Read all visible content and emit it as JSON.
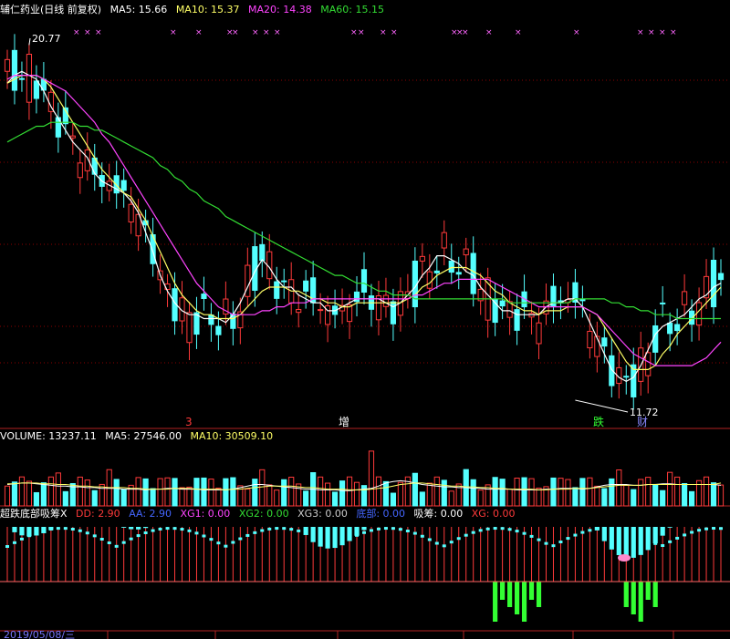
{
  "header": {
    "title": "辅仁药业(日线 前复权)",
    "ma5": "MA5: 15.66",
    "ma10": "MA10: 15.37",
    "ma20": "MA20: 14.38",
    "ma60": "MA60: 15.15"
  },
  "volume_header": {
    "title": "VOLUME: 13237.11",
    "ma5": "MA5: 27546.00",
    "ma10": "MA10: 30509.10"
  },
  "indicator_header": {
    "title": "超跌底部吸筹X",
    "dd": "DD: 2.90",
    "aa": "AA: 2.90",
    "xg1": "XG1: 0.00",
    "xg2": "XG2: 0.00",
    "xg3": "XG3: 0.00",
    "bottom": "底部: 0.00",
    "absorb": "吸筹: 0.00",
    "xg": "XG: 0.00"
  },
  "annotations": {
    "high_label": "20.77",
    "low_label": "11.72",
    "marker_1": "3",
    "marker_2": "增",
    "marker_3": "跌",
    "marker_4": "财"
  },
  "date_label": "2019/05/08/三",
  "colors": {
    "up": "#ff3a3a",
    "down": "#54ffff",
    "ma5": "#ffffff",
    "ma10": "#ffff66",
    "ma20": "#ff44ff",
    "ma60": "#33dd33",
    "grid": "#8b0000",
    "axis": "#b22222",
    "marker_x": "#ff66ff"
  },
  "chart_data": [
    {
      "type": "candlestick",
      "title": "辅仁药业(日线 前复权)",
      "ylim": [
        11,
        21.5
      ],
      "annotations": [
        {
          "text": "20.77",
          "x": 3,
          "y": 20.77
        },
        {
          "text": "11.72",
          "x": 112,
          "y": 11.72
        }
      ],
      "series": [
        {
          "name": "MA5",
          "values": [
            19.8,
            20.0,
            20.1,
            20.0,
            19.9,
            19.6,
            19.2,
            18.9,
            18.6,
            18.3,
            18.1,
            17.9,
            17.5,
            17.3,
            17.2,
            17.1,
            17.0,
            16.8,
            16.5,
            16.0,
            15.5,
            14.9,
            14.5,
            14.2,
            14.0,
            13.9,
            13.9,
            13.8,
            13.8,
            13.8,
            13.7,
            13.9,
            14.2,
            14.6,
            15.0,
            15.3,
            15.1,
            14.8,
            14.6,
            14.6,
            14.4,
            14.3,
            14.2,
            14.2,
            14.0,
            14.0,
            14.1,
            14.2,
            14.3,
            14.3,
            14.3,
            14.3,
            14.2,
            14.1,
            14.2,
            14.4,
            14.6,
            14.9,
            15.1,
            15.4,
            15.4,
            15.3,
            15.2,
            15.0,
            14.9,
            14.6,
            14.4,
            14.2,
            14.0,
            14.0,
            13.9,
            13.9,
            13.9,
            13.9,
            14.1,
            14.2,
            14.2,
            14.3,
            14.3,
            14.1,
            13.7,
            13.3,
            12.9,
            12.5,
            12.3,
            12.2,
            12.3,
            12.6,
            13.0,
            13.4,
            13.6,
            13.7,
            13.8,
            13.9,
            14.1,
            14.3,
            14.4,
            14.6,
            14.7
          ]
        },
        {
          "name": "MA10",
          "values": [
            19.8,
            19.9,
            20.0,
            20.0,
            20.0,
            19.9,
            19.7,
            19.4,
            19.1,
            18.8,
            18.5,
            18.2,
            17.9,
            17.6,
            17.4,
            17.2,
            17.0,
            16.9,
            16.6,
            16.3,
            15.9,
            15.5,
            15.1,
            14.7,
            14.4,
            14.2,
            14.0,
            13.9,
            13.9,
            13.8,
            13.8,
            13.8,
            13.9,
            14.1,
            14.3,
            14.5,
            14.6,
            14.6,
            14.6,
            14.5,
            14.5,
            14.4,
            14.3,
            14.3,
            14.2,
            14.2,
            14.1,
            14.1,
            14.2,
            14.2,
            14.2,
            14.2,
            14.2,
            14.2,
            14.2,
            14.3,
            14.4,
            14.6,
            14.7,
            14.9,
            15.0,
            15.1,
            15.1,
            15.1,
            15.0,
            14.9,
            14.7,
            14.5,
            14.4,
            14.2,
            14.1,
            14.0,
            14.0,
            13.9,
            14.0,
            14.0,
            14.0,
            14.1,
            14.1,
            14.1,
            14.0,
            13.9,
            13.6,
            13.3,
            13.0,
            12.7,
            12.5,
            12.5,
            12.5,
            12.6,
            12.9,
            13.1,
            13.4,
            13.6,
            13.8,
            14.0,
            14.2,
            14.4,
            14.6
          ]
        },
        {
          "name": "MA20",
          "values": [
            19.9,
            20.0,
            20.0,
            20.0,
            20.0,
            19.9,
            19.8,
            19.7,
            19.6,
            19.4,
            19.2,
            19.0,
            18.8,
            18.5,
            18.3,
            18.0,
            17.7,
            17.4,
            17.1,
            16.8,
            16.5,
            16.2,
            15.9,
            15.6,
            15.3,
            15.0,
            14.7,
            14.5,
            14.3,
            14.1,
            14.0,
            13.9,
            13.9,
            13.9,
            13.9,
            14.0,
            14.0,
            14.1,
            14.1,
            14.2,
            14.2,
            14.2,
            14.3,
            14.3,
            14.3,
            14.3,
            14.3,
            14.3,
            14.3,
            14.3,
            14.3,
            14.3,
            14.3,
            14.3,
            14.3,
            14.3,
            14.4,
            14.4,
            14.5,
            14.6,
            14.7,
            14.7,
            14.8,
            14.8,
            14.8,
            14.8,
            14.8,
            14.7,
            14.6,
            14.5,
            14.4,
            14.3,
            14.2,
            14.1,
            14.1,
            14.1,
            14.1,
            14.1,
            14.1,
            14.1,
            14.0,
            13.9,
            13.7,
            13.5,
            13.3,
            13.1,
            12.9,
            12.8,
            12.7,
            12.6,
            12.6,
            12.6,
            12.6,
            12.6,
            12.6,
            12.7,
            12.8,
            13.0,
            13.2
          ]
        },
        {
          "name": "MA60",
          "values": [
            18.3,
            18.4,
            18.5,
            18.6,
            18.7,
            18.7,
            18.8,
            18.8,
            18.8,
            18.8,
            18.7,
            18.7,
            18.6,
            18.6,
            18.5,
            18.4,
            18.3,
            18.2,
            18.1,
            18.0,
            17.9,
            17.7,
            17.6,
            17.4,
            17.3,
            17.1,
            17.0,
            16.8,
            16.7,
            16.6,
            16.4,
            16.3,
            16.2,
            16.1,
            16.0,
            15.9,
            15.8,
            15.7,
            15.6,
            15.5,
            15.4,
            15.3,
            15.2,
            15.1,
            15.0,
            14.9,
            14.9,
            14.8,
            14.7,
            14.7,
            14.6,
            14.5,
            14.5,
            14.4,
            14.4,
            14.4,
            14.3,
            14.3,
            14.3,
            14.3,
            14.3,
            14.3,
            14.3,
            14.3,
            14.3,
            14.3,
            14.3,
            14.3,
            14.3,
            14.2,
            14.2,
            14.2,
            14.2,
            14.2,
            14.2,
            14.2,
            14.2,
            14.2,
            14.3,
            14.3,
            14.3,
            14.3,
            14.3,
            14.2,
            14.2,
            14.1,
            14.1,
            14.0,
            14.0,
            13.9,
            13.9,
            13.9,
            13.8,
            13.8,
            13.8,
            13.8,
            13.8,
            13.8,
            13.8
          ]
        }
      ]
    },
    {
      "type": "bar",
      "title": "VOLUME: 13237.11",
      "series": [
        {
          "name": "MA5",
          "values": [
            28,
            29,
            30,
            30,
            29,
            28,
            27,
            26,
            26,
            25,
            25,
            24,
            24,
            23,
            23,
            23,
            22,
            22,
            22,
            21,
            22,
            22,
            23,
            23,
            22,
            22,
            22,
            21,
            21,
            21,
            21,
            22,
            24,
            26,
            28,
            28,
            27,
            26,
            25,
            24,
            23,
            22,
            22,
            21,
            21,
            21,
            20,
            20,
            21,
            22,
            23,
            26,
            30,
            32,
            33,
            32,
            30,
            28,
            27,
            26,
            25,
            25,
            24,
            24,
            23,
            23,
            22,
            22,
            22,
            22,
            21,
            21,
            21,
            21,
            22,
            22,
            23,
            23,
            23,
            22,
            23,
            25,
            27,
            28,
            28,
            28,
            27,
            27,
            28,
            28,
            29,
            29,
            28,
            28,
            28,
            28,
            28,
            28,
            27
          ]
        },
        {
          "name": "MA10",
          "values": [
            29,
            29,
            30,
            30,
            30,
            29,
            29,
            28,
            28,
            27,
            26,
            26,
            25,
            25,
            24,
            24,
            24,
            23,
            23,
            22,
            22,
            22,
            22,
            23,
            23,
            23,
            22,
            22,
            22,
            22,
            21,
            22,
            22,
            23,
            24,
            25,
            26,
            26,
            26,
            26,
            25,
            24,
            24,
            23,
            22,
            22,
            22,
            21,
            21,
            21,
            22,
            23,
            24,
            26,
            28,
            29,
            30,
            30,
            29,
            28,
            27,
            26,
            26,
            25,
            25,
            24,
            24,
            23,
            23,
            22,
            22,
            22,
            22,
            21,
            21,
            22,
            22,
            22,
            23,
            23,
            23,
            24,
            25,
            26,
            27,
            27,
            27,
            27,
            28,
            28,
            28,
            28,
            28,
            28,
            28,
            28,
            28,
            28,
            30
          ]
        }
      ]
    },
    {
      "type": "bar",
      "title": "超跌底部吸筹X",
      "series": [
        {
          "name": "DD",
          "values": [
            2.9
          ]
        },
        {
          "name": "AA",
          "values": [
            2.9
          ]
        },
        {
          "name": "XG1",
          "values": [
            0.0
          ]
        },
        {
          "name": "XG2",
          "values": [
            0.0
          ]
        },
        {
          "name": "XG3",
          "values": [
            0.0
          ]
        },
        {
          "name": "底部",
          "values": [
            0.0
          ]
        },
        {
          "name": "吸筹",
          "values": [
            0.0
          ]
        },
        {
          "name": "XG",
          "values": [
            0.0
          ]
        }
      ]
    }
  ]
}
